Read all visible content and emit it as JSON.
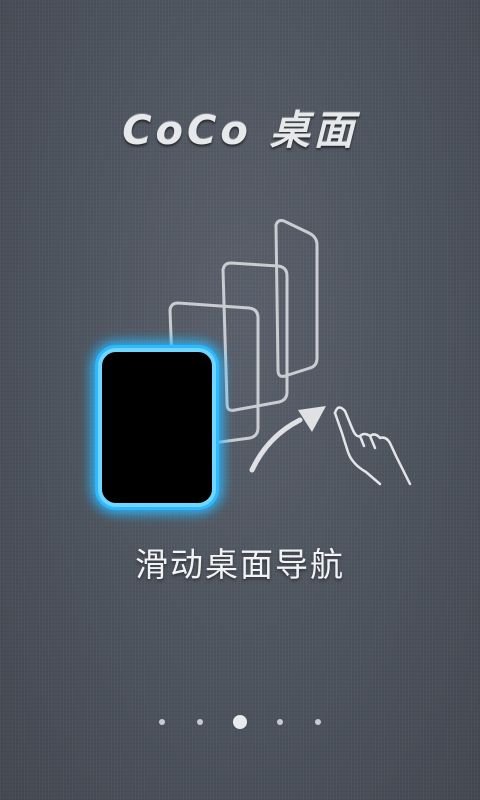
{
  "title": "CoCo 桌面",
  "caption": "滑动桌面导航",
  "pager": {
    "count": 5,
    "active_index": 2
  },
  "illustration": {
    "icons": [
      "phone-screen-icon",
      "stacked-screens-icon",
      "swipe-arrow-icon",
      "hand-swipe-icon"
    ],
    "glow_color": "#2fb8ff"
  }
}
